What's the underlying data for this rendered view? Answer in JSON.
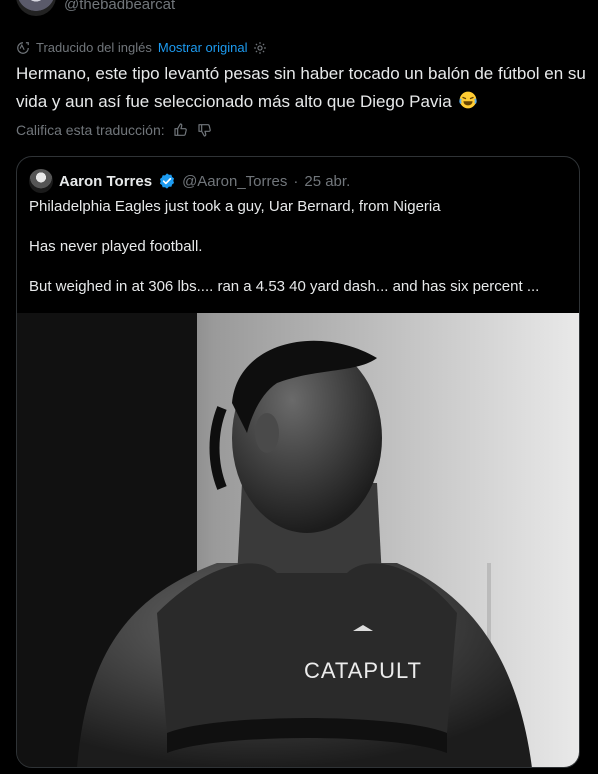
{
  "top": {
    "handle": "@thebadbearcat"
  },
  "translation": {
    "note": "Traducido del inglés",
    "show_original": "Mostrar original"
  },
  "tweet": {
    "text": "Hermano, este tipo levantó pesas sin haber tocado un balón de fútbol en su vida y aun así fue seleccionado más alto que Diego Pavia",
    "emoji": "face-with-tears-of-joy"
  },
  "rate": {
    "label": "Califica esta traducción:"
  },
  "quote": {
    "name": "Aaron Torres",
    "handle": "@Aaron_Torres",
    "separator": "·",
    "date": "25 abr.",
    "text": "Philadelphia Eagles just took a guy, Uar Bernard, from Nigeria\n\nHas never played football.\n\nBut weighed in at 306 lbs.... ran a 4.53 40 yard dash... and has six percent ...",
    "media_brand": "CATAPULT"
  },
  "colors": {
    "background": "#000000",
    "text": "#e7e9ea",
    "secondary": "#71767b",
    "link": "#1d9bf0",
    "border": "#2f3336",
    "verified": "#1d9bf0"
  }
}
